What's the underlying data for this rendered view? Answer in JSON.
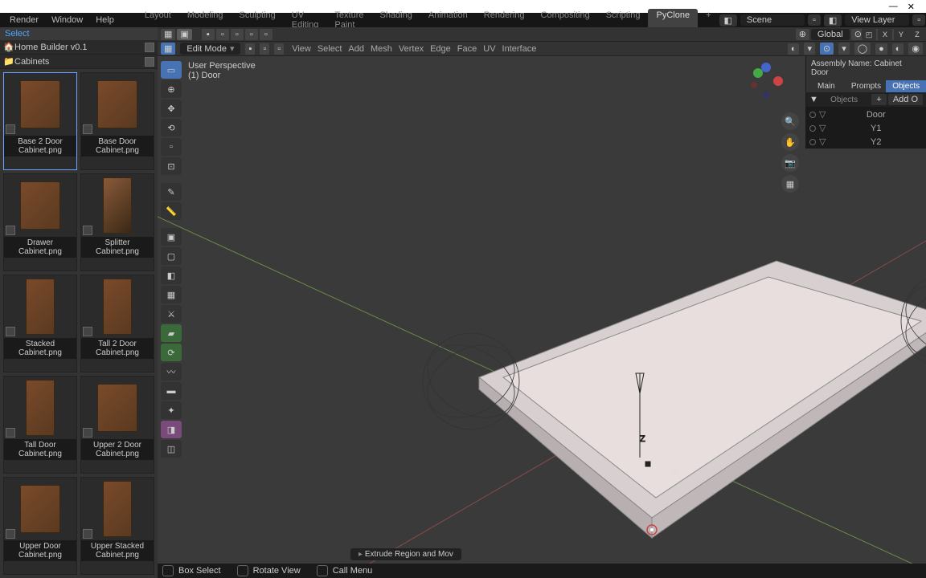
{
  "titlebar": {
    "min": "—",
    "close": "✕"
  },
  "menu": {
    "file": [
      "Render",
      "Window",
      "Help"
    ],
    "tabs": [
      "Layout",
      "Modeling",
      "Sculpting",
      "UV Editing",
      "Texture Paint",
      "Shading",
      "Animation",
      "Rendering",
      "Compositing",
      "Scripting",
      "PyClone",
      "+"
    ],
    "active_tab": "PyClone",
    "scene": "Scene",
    "viewlayer": "View Layer"
  },
  "left": {
    "select": "Select",
    "tree": [
      {
        "icon": "🏠",
        "label": "Home Builder v0.1"
      },
      {
        "icon": "📁",
        "label": "Cabinets"
      }
    ],
    "thumbs": [
      {
        "label": "Base 2 Door Cabinet.png",
        "sel": true,
        "type": ""
      },
      {
        "label": "Base Door Cabinet.png",
        "type": ""
      },
      {
        "label": "Drawer Cabinet.png",
        "type": ""
      },
      {
        "label": "Splitter Cabinet.png",
        "type": "split"
      },
      {
        "label": "Stacked Cabinet.png",
        "type": "tall"
      },
      {
        "label": "Tall 2 Door Cabinet.png",
        "type": "tall"
      },
      {
        "label": "Tall Door Cabinet.png",
        "type": "tall"
      },
      {
        "label": "Upper 2 Door Cabinet.png",
        "type": ""
      },
      {
        "label": "Upper Door Cabinet.png",
        "type": ""
      },
      {
        "label": "Upper Stacked Cabinet.png",
        "type": "tall"
      }
    ]
  },
  "viewport": {
    "mode": "Edit Mode",
    "menus": [
      "View",
      "Select",
      "Add",
      "Mesh",
      "Vertex",
      "Edge",
      "Face",
      "UV",
      "Interface"
    ],
    "orient": "Global",
    "persp": "User Perspective",
    "obj": "(1) Door",
    "hint": "Extrude Region and Mov",
    "axes": [
      "X",
      "Y",
      "Z"
    ]
  },
  "rpanel": {
    "title": "Assembly Name: Cabinet Door",
    "tabs": [
      "Main",
      "Prompts",
      "Objects"
    ],
    "active": "Objects",
    "section": "Objects",
    "add": "Add O",
    "items": [
      "Door",
      "Y1",
      "Y2"
    ]
  },
  "status": {
    "left": "Box Select",
    "mid": "Rotate View",
    "right": "Call Menu"
  },
  "chart_data": null
}
